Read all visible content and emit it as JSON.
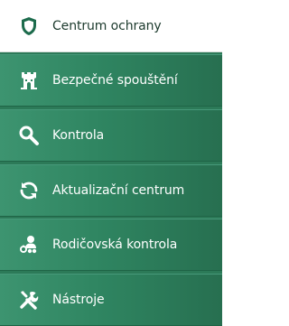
{
  "sidebar": {
    "items": [
      {
        "label": "Centrum ochrany",
        "icon": "shield-icon",
        "active": true
      },
      {
        "label": "Bezpečné spouštění",
        "icon": "castle-tower-icon",
        "active": false
      },
      {
        "label": "Kontrola",
        "icon": "magnifier-icon",
        "active": false
      },
      {
        "label": "Aktualizační centrum",
        "icon": "refresh-icon",
        "active": false
      },
      {
        "label": "Rodičovská kontrola",
        "icon": "parental-control-icon",
        "active": false
      },
      {
        "label": "Nástroje",
        "icon": "tools-icon",
        "active": false
      }
    ]
  },
  "colors": {
    "active_background": "#ffffff",
    "sidebar_green": "#2f8561",
    "active_icon": "#1c6b4c"
  }
}
